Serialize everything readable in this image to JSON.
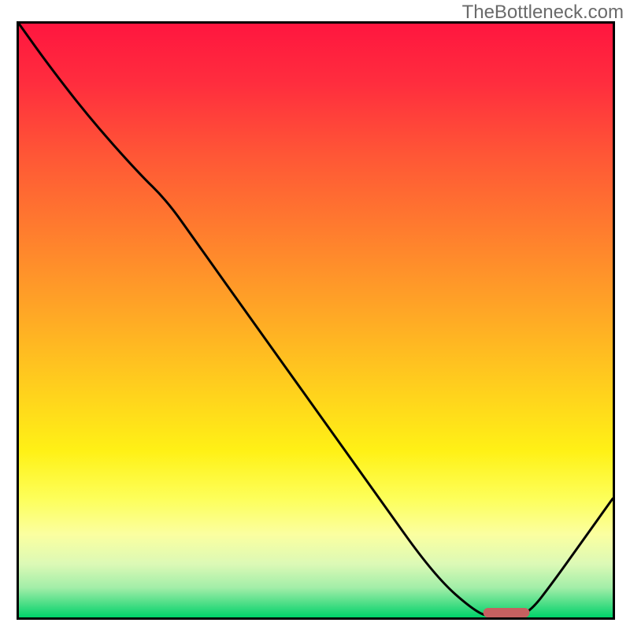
{
  "watermark_text": "TheBottleneck.com",
  "chart_data": {
    "type": "line",
    "title": "",
    "xlabel": "",
    "ylabel": "",
    "xlim": [
      0,
      100
    ],
    "ylim": [
      0,
      100
    ],
    "grid": false,
    "legend": false,
    "gradient_stops": [
      {
        "offset": 0.0,
        "color": "#ff163f"
      },
      {
        "offset": 0.1,
        "color": "#ff2d3e"
      },
      {
        "offset": 0.22,
        "color": "#ff5636"
      },
      {
        "offset": 0.35,
        "color": "#ff7d2e"
      },
      {
        "offset": 0.48,
        "color": "#ffa526"
      },
      {
        "offset": 0.6,
        "color": "#ffcb1e"
      },
      {
        "offset": 0.72,
        "color": "#fff116"
      },
      {
        "offset": 0.8,
        "color": "#fdff5a"
      },
      {
        "offset": 0.86,
        "color": "#fbffa0"
      },
      {
        "offset": 0.91,
        "color": "#dcf9b6"
      },
      {
        "offset": 0.95,
        "color": "#a2eea8"
      },
      {
        "offset": 0.975,
        "color": "#52df89"
      },
      {
        "offset": 1.0,
        "color": "#00d26a"
      }
    ],
    "series": [
      {
        "name": "bottleneck-curve",
        "color": "#000000",
        "stroke_width": 3,
        "x": [
          0.0,
          5.0,
          12.0,
          20.0,
          25.0,
          30.0,
          40.0,
          50.0,
          60.0,
          70.0,
          77.0,
          80.0,
          83.0,
          86.0,
          90.0,
          95.0,
          100.0
        ],
        "y": [
          100.0,
          93.0,
          84.0,
          75.0,
          70.1,
          63.0,
          49.0,
          35.0,
          21.0,
          7.0,
          0.8,
          0.0,
          0.0,
          0.8,
          6.0,
          13.0,
          20.0
        ]
      }
    ],
    "optimal_marker": {
      "name": "optimal-range",
      "color": "#c66060",
      "x_start": 78.2,
      "x_end": 86.0,
      "y": 0.8,
      "thickness_px": 12
    }
  }
}
